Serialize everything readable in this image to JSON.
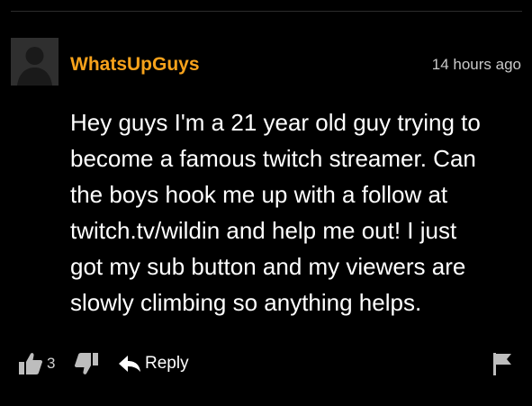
{
  "comment": {
    "username": "WhatsUpGuys",
    "timestamp": "14 hours ago",
    "body_lines": [
      "Hey guys I'm a 21 year old guy trying to",
      "become a famous twitch streamer. Can",
      "the boys hook me up with a follow at",
      "twitch.tv/wildin and help me out! I just",
      "got my sub button and my viewers are",
      "slowly climbing so anything helps."
    ],
    "actions": {
      "like_count": "3",
      "reply_label": "Reply"
    }
  },
  "colors": {
    "background": "#000000",
    "username": "#f7a21b",
    "text": "#ffffff",
    "muted": "#bdbdbd"
  },
  "icons": {
    "avatar": "default-avatar",
    "like": "thumbs-up-icon",
    "dislike": "thumbs-down-icon",
    "reply": "reply-arrow-icon",
    "flag": "flag-icon"
  }
}
